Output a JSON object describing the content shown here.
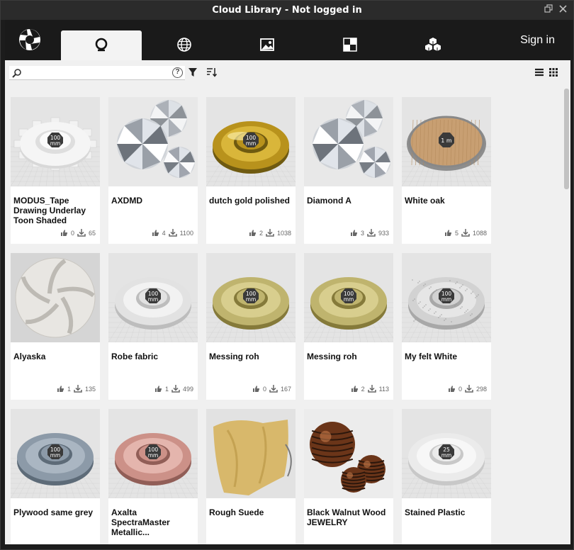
{
  "window": {
    "title": "Cloud Library - Not logged in",
    "restore_icon": "restore-window-icon",
    "close_icon": "close-icon"
  },
  "nav": {
    "tabs": [
      {
        "name": "tab-search",
        "icon": "search-icon",
        "active": true
      },
      {
        "name": "tab-online",
        "icon": "globe-icon",
        "active": false
      },
      {
        "name": "tab-images",
        "icon": "image-icon",
        "active": false
      },
      {
        "name": "tab-textures",
        "icon": "checker-icon",
        "active": false
      },
      {
        "name": "tab-models",
        "icon": "cubes-icon",
        "active": false
      }
    ],
    "signin_label": "Sign in"
  },
  "search": {
    "value": "",
    "placeholder": ""
  },
  "colors": {
    "nav_bg": "#1a1a1a",
    "content_bg": "#f0f0f0",
    "card_bg": "#ffffff"
  },
  "materials": [
    {
      "name": "MODUS_Tape Drawing Underlay Toon Shaded",
      "likes": "0",
      "downloads": "65",
      "thumb": "white-gear",
      "badge": "100\nmm"
    },
    {
      "name": "AXDMD",
      "likes": "4",
      "downloads": "1100",
      "thumb": "diamond",
      "badge": ""
    },
    {
      "name": "dutch gold polished",
      "likes": "2",
      "downloads": "1038",
      "thumb": "gold",
      "badge": "100\nmm"
    },
    {
      "name": "Diamond A",
      "likes": "3",
      "downloads": "933",
      "thumb": "diamond",
      "badge": ""
    },
    {
      "name": "White oak",
      "likes": "5",
      "downloads": "1088",
      "thumb": "oak",
      "badge": "1 m"
    },
    {
      "name": "Alyaska",
      "likes": "1",
      "downloads": "135",
      "thumb": "sphere-white",
      "badge": ""
    },
    {
      "name": "Robe fabric",
      "likes": "1",
      "downloads": "499",
      "thumb": "white-disc",
      "badge": "100\nmm"
    },
    {
      "name": "Messing roh",
      "likes": "0",
      "downloads": "167",
      "thumb": "brass",
      "badge": "100\nmm"
    },
    {
      "name": "Messing roh",
      "likes": "2",
      "downloads": "113",
      "thumb": "brass",
      "badge": "100\nmm"
    },
    {
      "name": "My felt White",
      "likes": "0",
      "downloads": "298",
      "thumb": "felt",
      "badge": "100\nmm"
    },
    {
      "name": "Plywood same grey",
      "likes": "",
      "downloads": "",
      "thumb": "blue-grey",
      "badge": "100\nmm"
    },
    {
      "name": "Axalta SpectraMaster Metallic...",
      "likes": "",
      "downloads": "",
      "thumb": "pink",
      "badge": "100\nmm"
    },
    {
      "name": "Rough Suede",
      "likes": "",
      "downloads": "",
      "thumb": "suede",
      "badge": ""
    },
    {
      "name": "Black Walnut Wood JEWELRY",
      "likes": "",
      "downloads": "",
      "thumb": "walnut",
      "badge": ""
    },
    {
      "name": "Stained Plastic",
      "likes": "",
      "downloads": "",
      "thumb": "white-plastic",
      "badge": "25\nmm"
    }
  ]
}
